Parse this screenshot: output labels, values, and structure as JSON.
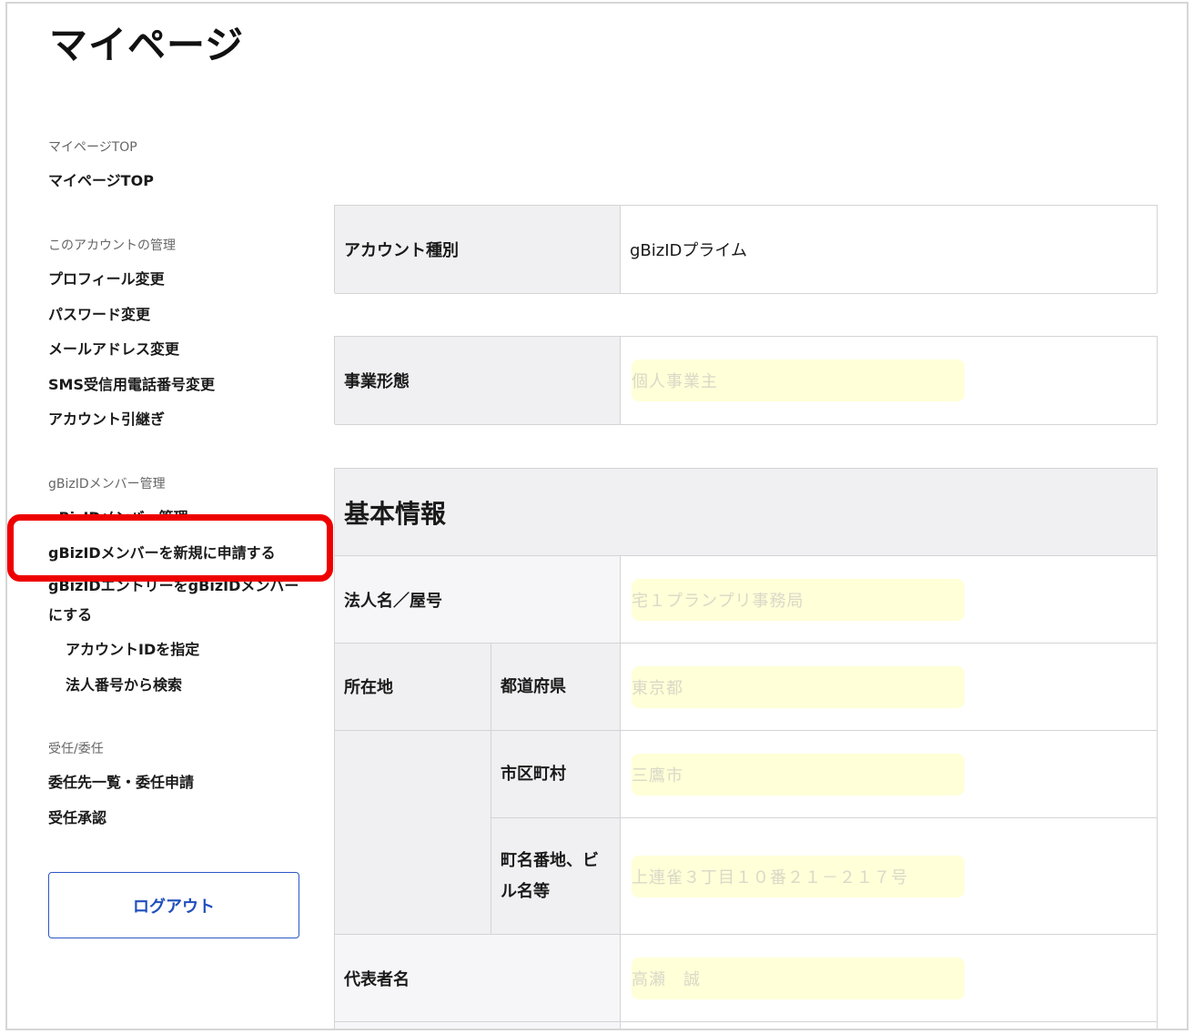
{
  "page": {
    "title": "マイページ"
  },
  "sidebar": {
    "sections": [
      {
        "heading": "マイページTOP",
        "items": [
          "マイページTOP"
        ]
      },
      {
        "heading": "このアカウントの管理",
        "items": [
          "プロフィール変更",
          "パスワード変更",
          "メールアドレス変更",
          "SMS受信用電話番号変更",
          "アカウント引継ぎ"
        ]
      },
      {
        "heading": "gBizIDメンバー管理",
        "items": [
          "gBizIDメンバー管理",
          "gBizIDメンバーを新規に申請する",
          "gBizIDエントリーをgBizIDメンバーにする",
          "アカウントIDを指定",
          "法人番号から検索"
        ]
      },
      {
        "heading": "受任/委任",
        "items": [
          "委任先一覧・委任申請",
          "受任承認"
        ]
      }
    ],
    "logout_label": "ログアウト"
  },
  "account": {
    "type_label": "アカウント種別",
    "type_value": "gBizIDプライム",
    "business_label": "事業形態",
    "business_value": "個人事業主"
  },
  "basic_info": {
    "heading": "基本情報",
    "corp_name_label": "法人名／屋号",
    "corp_name_value": "宅１プランプリ事務局",
    "location_label": "所在地",
    "prefecture_label": "都道府県",
    "prefecture_value": "東京都",
    "city_label": "市区町村",
    "city_value": "三鷹市",
    "address_label": "町名番地、ビル名等",
    "address_value": "上連雀３丁目１０番２１－２１７号",
    "representative_label": "代表者名",
    "representative_value": "高瀬　誠"
  },
  "colors": {
    "highlight": "#ee0000",
    "mask": "#ffffd8",
    "link_blue": "#1f4fbe",
    "header_bg": "#f0f0f2"
  }
}
